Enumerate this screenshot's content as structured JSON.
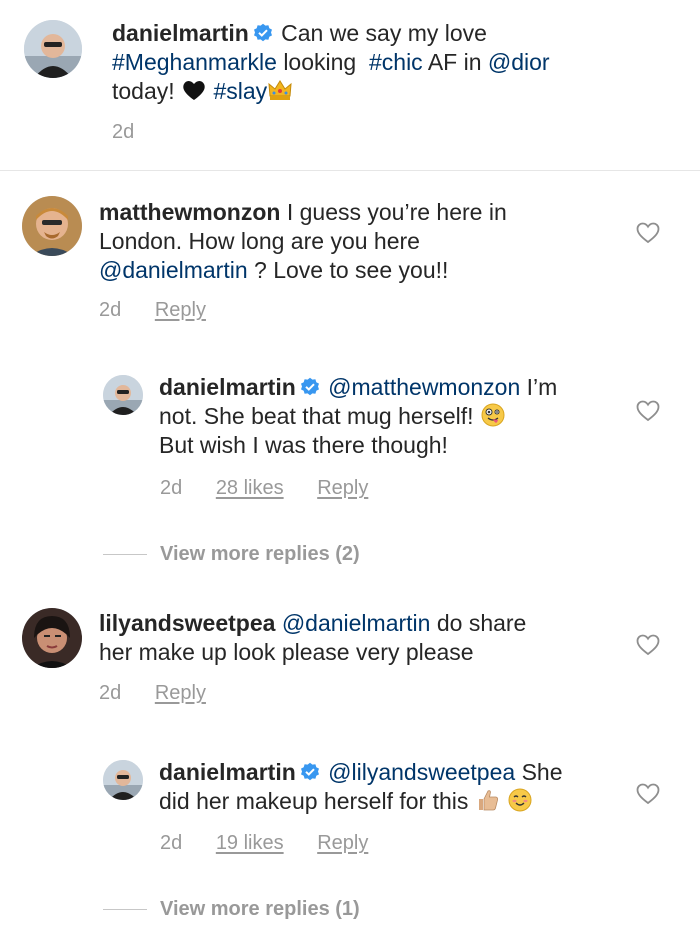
{
  "caption": {
    "username": "danielmartin",
    "text_1": "Can we say my love",
    "tag_meghan": "#Meghanmarkle",
    "text_2": "looking",
    "tag_chic": "#chic",
    "text_3": "AF in",
    "mention_dior": "@dior",
    "text_4": "today!",
    "tag_slay": "#slay",
    "time": "2d"
  },
  "comments": [
    {
      "username": "matthewmonzon",
      "text_1": "I guess you’re here in",
      "text_2": "London.  How long are you here",
      "mention": "@danielmartin",
      "text_3": "?  Love to see you!!",
      "time": "2d",
      "reply_label": "Reply",
      "replies": [
        {
          "username": "danielmartin",
          "mention": "@matthewmonzon",
          "text_1": "I’m",
          "text_2": "not. She beat that mug herself!",
          "text_3": "But wish I was there though!",
          "time": "2d",
          "likes": "28 likes",
          "reply_label": "Reply"
        }
      ],
      "view_more": "View more replies (2)"
    },
    {
      "username": "lilyandsweetpea",
      "mention": "@danielmartin",
      "text_1": "do share",
      "text_2": "her make up look please very please",
      "time": "2d",
      "reply_label": "Reply",
      "replies": [
        {
          "username": "danielmartin",
          "mention": "@lilyandsweetpea",
          "text_1": "She",
          "text_2": "did her makeup herself for this",
          "time": "2d",
          "likes": "19 likes",
          "reply_label": "Reply"
        }
      ],
      "view_more": "View more replies (1)"
    }
  ],
  "colors": {
    "link": "#003569",
    "meta": "#999999",
    "verified": "#3897f0",
    "text": "#262626"
  },
  "icons": [
    "verified-badge-icon",
    "heart-outline-icon",
    "black-heart-emoji",
    "crown-emoji",
    "zany-face-emoji",
    "thumbs-up-emoji",
    "smiling-face-emoji"
  ]
}
